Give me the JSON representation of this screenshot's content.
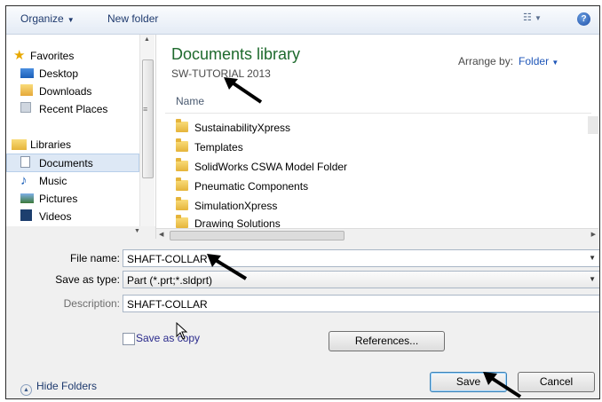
{
  "toolbar": {
    "organize_label": "Organize",
    "new_folder_label": "New folder"
  },
  "nav": {
    "items": [
      {
        "label": "Favorites",
        "icon": "star-icon"
      },
      {
        "label": "Desktop",
        "icon": "desktop-icon"
      },
      {
        "label": "Downloads",
        "icon": "downloads-icon"
      },
      {
        "label": "Recent Places",
        "icon": "recent-places-icon"
      },
      {
        "label": "Libraries",
        "icon": "libraries-icon"
      },
      {
        "label": "Documents",
        "icon": "documents-icon"
      },
      {
        "label": "Music",
        "icon": "music-icon"
      },
      {
        "label": "Pictures",
        "icon": "pictures-icon"
      },
      {
        "label": "Videos",
        "icon": "videos-icon"
      }
    ]
  },
  "main": {
    "library_title": "Documents library",
    "library_subtitle": "SW-TUTORIAL 2013",
    "arrange_by_label": "Arrange by:",
    "arrange_by_value": "Folder",
    "column_name": "Name",
    "files": [
      "SustainabilityXpress",
      "Templates",
      "SolidWorks CSWA Model Folder",
      "Pneumatic Components",
      "SimulationXpress",
      "Drawing Solutions"
    ]
  },
  "form": {
    "file_name_label": "File name:",
    "file_name_value": "SHAFT-COLLAR",
    "save_as_type_label": "Save as type:",
    "save_as_type_value": "Part (*.prt;*.sldprt)",
    "description_label": "Description:",
    "description_value": "SHAFT-COLLAR",
    "save_as_copy_label": "Save as copy",
    "references_label": "References..."
  },
  "footer": {
    "hide_folders_label": "Hide Folders",
    "save_label": "Save",
    "cancel_label": "Cancel"
  },
  "colors": {
    "library_title": "#1e6a2d",
    "link": "#1e56b8",
    "selection": "#dde8f5"
  }
}
